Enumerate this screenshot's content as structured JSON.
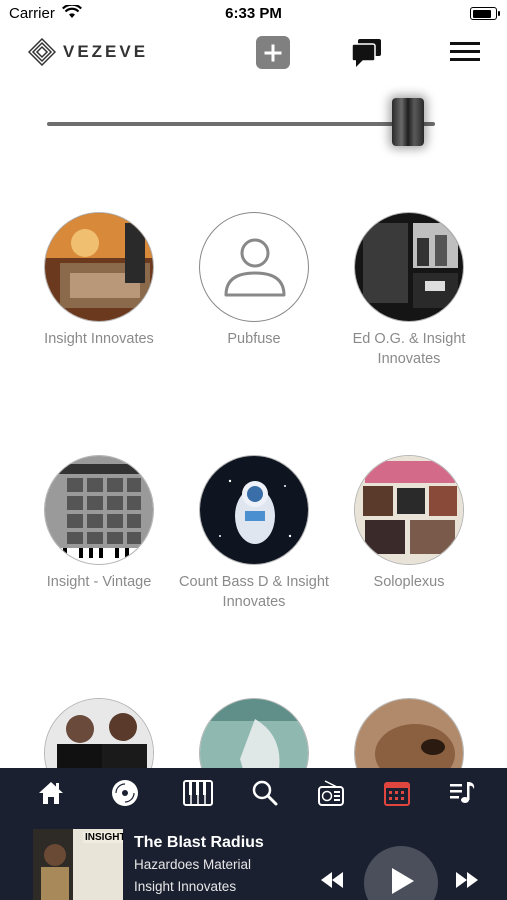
{
  "status_bar": {
    "carrier": "Carrier",
    "time": "6:33 PM",
    "battery_level": 0.9
  },
  "header": {
    "logo_text": "VEZEVE",
    "add_icon": "plus-icon",
    "chat_icon": "chat-bubbles-icon",
    "menu_icon": "hamburger-menu-icon"
  },
  "slider": {
    "value": 0.93
  },
  "artists": [
    {
      "name": "Insight Innovates",
      "image": "studio-photo"
    },
    {
      "name": "Pubfuse",
      "image": "default-person-icon"
    },
    {
      "name": "Ed O.G. & Insight Innovates",
      "image": "album-back-cover"
    },
    {
      "name": "Insight - Vintage",
      "image": "drum-machine"
    },
    {
      "name": "Count Bass D & Insight Innovates",
      "image": "astronaut-art"
    },
    {
      "name": "Soloplexus",
      "image": "collage-art"
    },
    {
      "name": "",
      "image": "two-men-photo"
    },
    {
      "name": "",
      "image": "teal-album-art"
    },
    {
      "name": "",
      "image": "dog-photo"
    }
  ],
  "tabs": [
    {
      "icon": "home-icon",
      "active": false
    },
    {
      "icon": "vinyl-disc-icon",
      "active": false
    },
    {
      "icon": "piano-keys-icon",
      "active": false
    },
    {
      "icon": "search-icon",
      "active": false
    },
    {
      "icon": "radio-icon",
      "active": false
    },
    {
      "icon": "calendar-icon",
      "active": true
    },
    {
      "icon": "music-list-icon",
      "active": false
    }
  ],
  "now_playing": {
    "cover_text": "INSIGHT",
    "title": "The Blast Radius",
    "album": "Hazardoes Material",
    "artist": "Insight Innovates"
  },
  "colors": {
    "bar_bg": "#1b2030",
    "active_tab": "#e0463e",
    "tab_icon": "#ffffff",
    "name_text": "#8a8a8a"
  }
}
